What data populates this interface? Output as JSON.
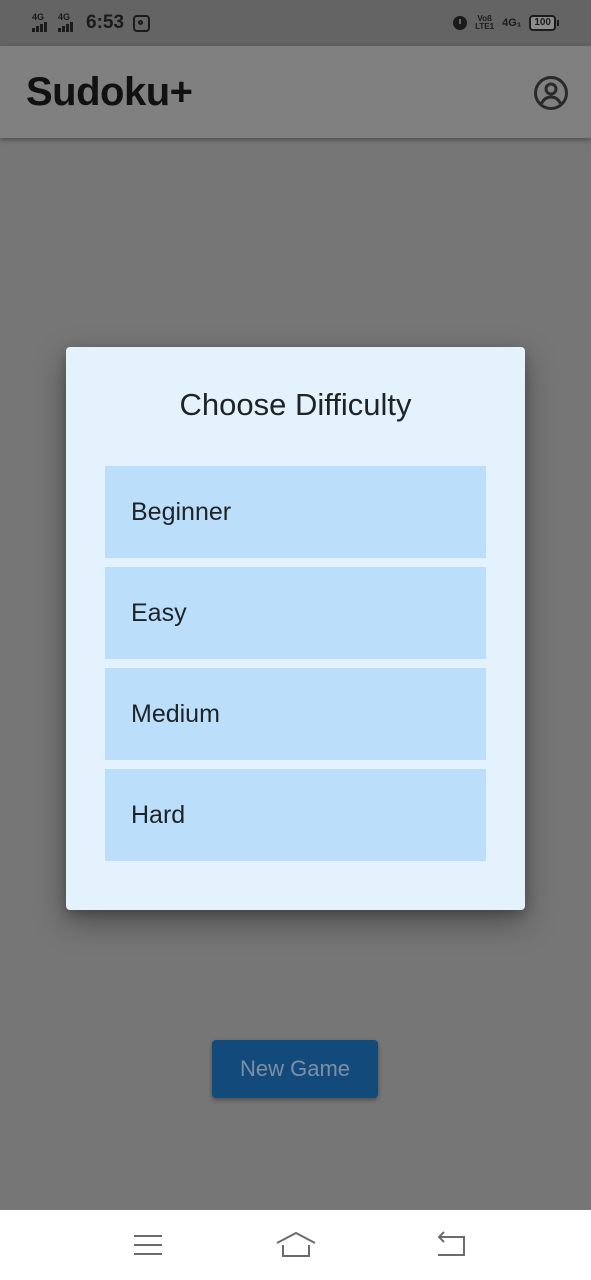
{
  "status_bar": {
    "network_left_1": "4G",
    "network_left_2": "4G",
    "time": "6:53",
    "volte_line1": "Voß",
    "volte_line2": "LTE1",
    "network_right": "4G₁",
    "battery": "100"
  },
  "app_bar": {
    "title": "Sudoku+",
    "account_icon": "account-circle-icon"
  },
  "dialog": {
    "title": "Choose Difficulty",
    "options": [
      {
        "label": "Beginner"
      },
      {
        "label": "Easy"
      },
      {
        "label": "Medium"
      },
      {
        "label": "Hard"
      }
    ]
  },
  "main": {
    "new_game_label": "New Game"
  },
  "nav_bar": {
    "menu_icon": "menu-icon",
    "home_icon": "home-icon",
    "back_icon": "back-icon"
  },
  "colors": {
    "dialog_background": "#e3f2fd",
    "option_background": "#bbdefb",
    "scrim_background": "#767676",
    "button_background": "#134a7c"
  }
}
